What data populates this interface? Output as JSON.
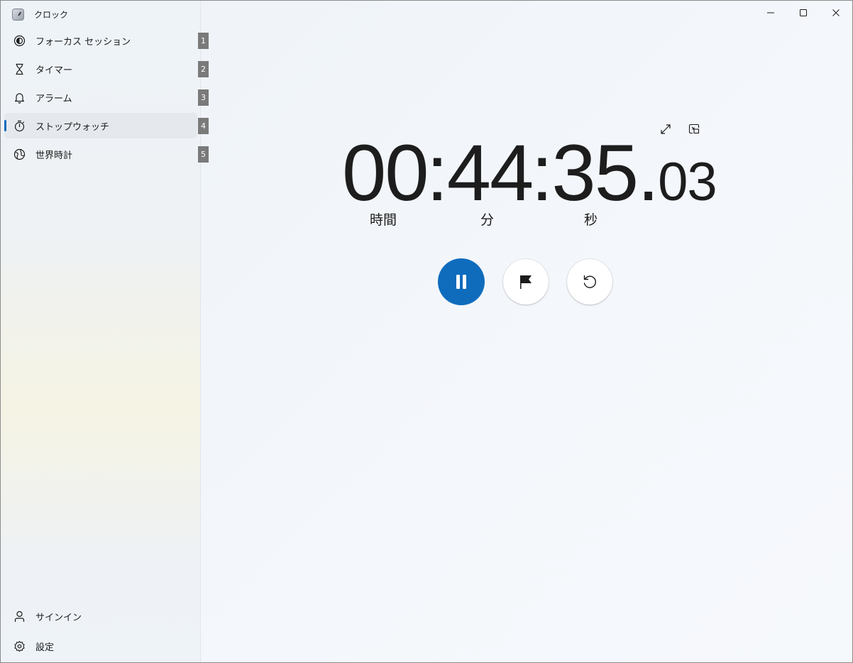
{
  "app": {
    "title": "クロック"
  },
  "nav": {
    "items": [
      {
        "label": "フォーカス セッション",
        "badge": "1",
        "icon": "focus-icon"
      },
      {
        "label": "タイマー",
        "badge": "2",
        "icon": "hourglass-icon"
      },
      {
        "label": "アラーム",
        "badge": "3",
        "icon": "bell-icon"
      },
      {
        "label": "ストップウォッチ",
        "badge": "4",
        "icon": "stopwatch-icon",
        "active": true
      },
      {
        "label": "世界時計",
        "badge": "5",
        "icon": "globe-icon"
      }
    ],
    "bottom": [
      {
        "label": "サインイン",
        "icon": "person-icon"
      },
      {
        "label": "設定",
        "icon": "gear-icon"
      }
    ]
  },
  "stopwatch": {
    "hours": "00",
    "minutes": "44",
    "seconds": "35",
    "fraction": "03",
    "units": {
      "hours": "時間",
      "minutes": "分",
      "seconds": "秒"
    }
  },
  "colors": {
    "accent": "#0f6cbd",
    "badge": "#7a7a7a"
  }
}
